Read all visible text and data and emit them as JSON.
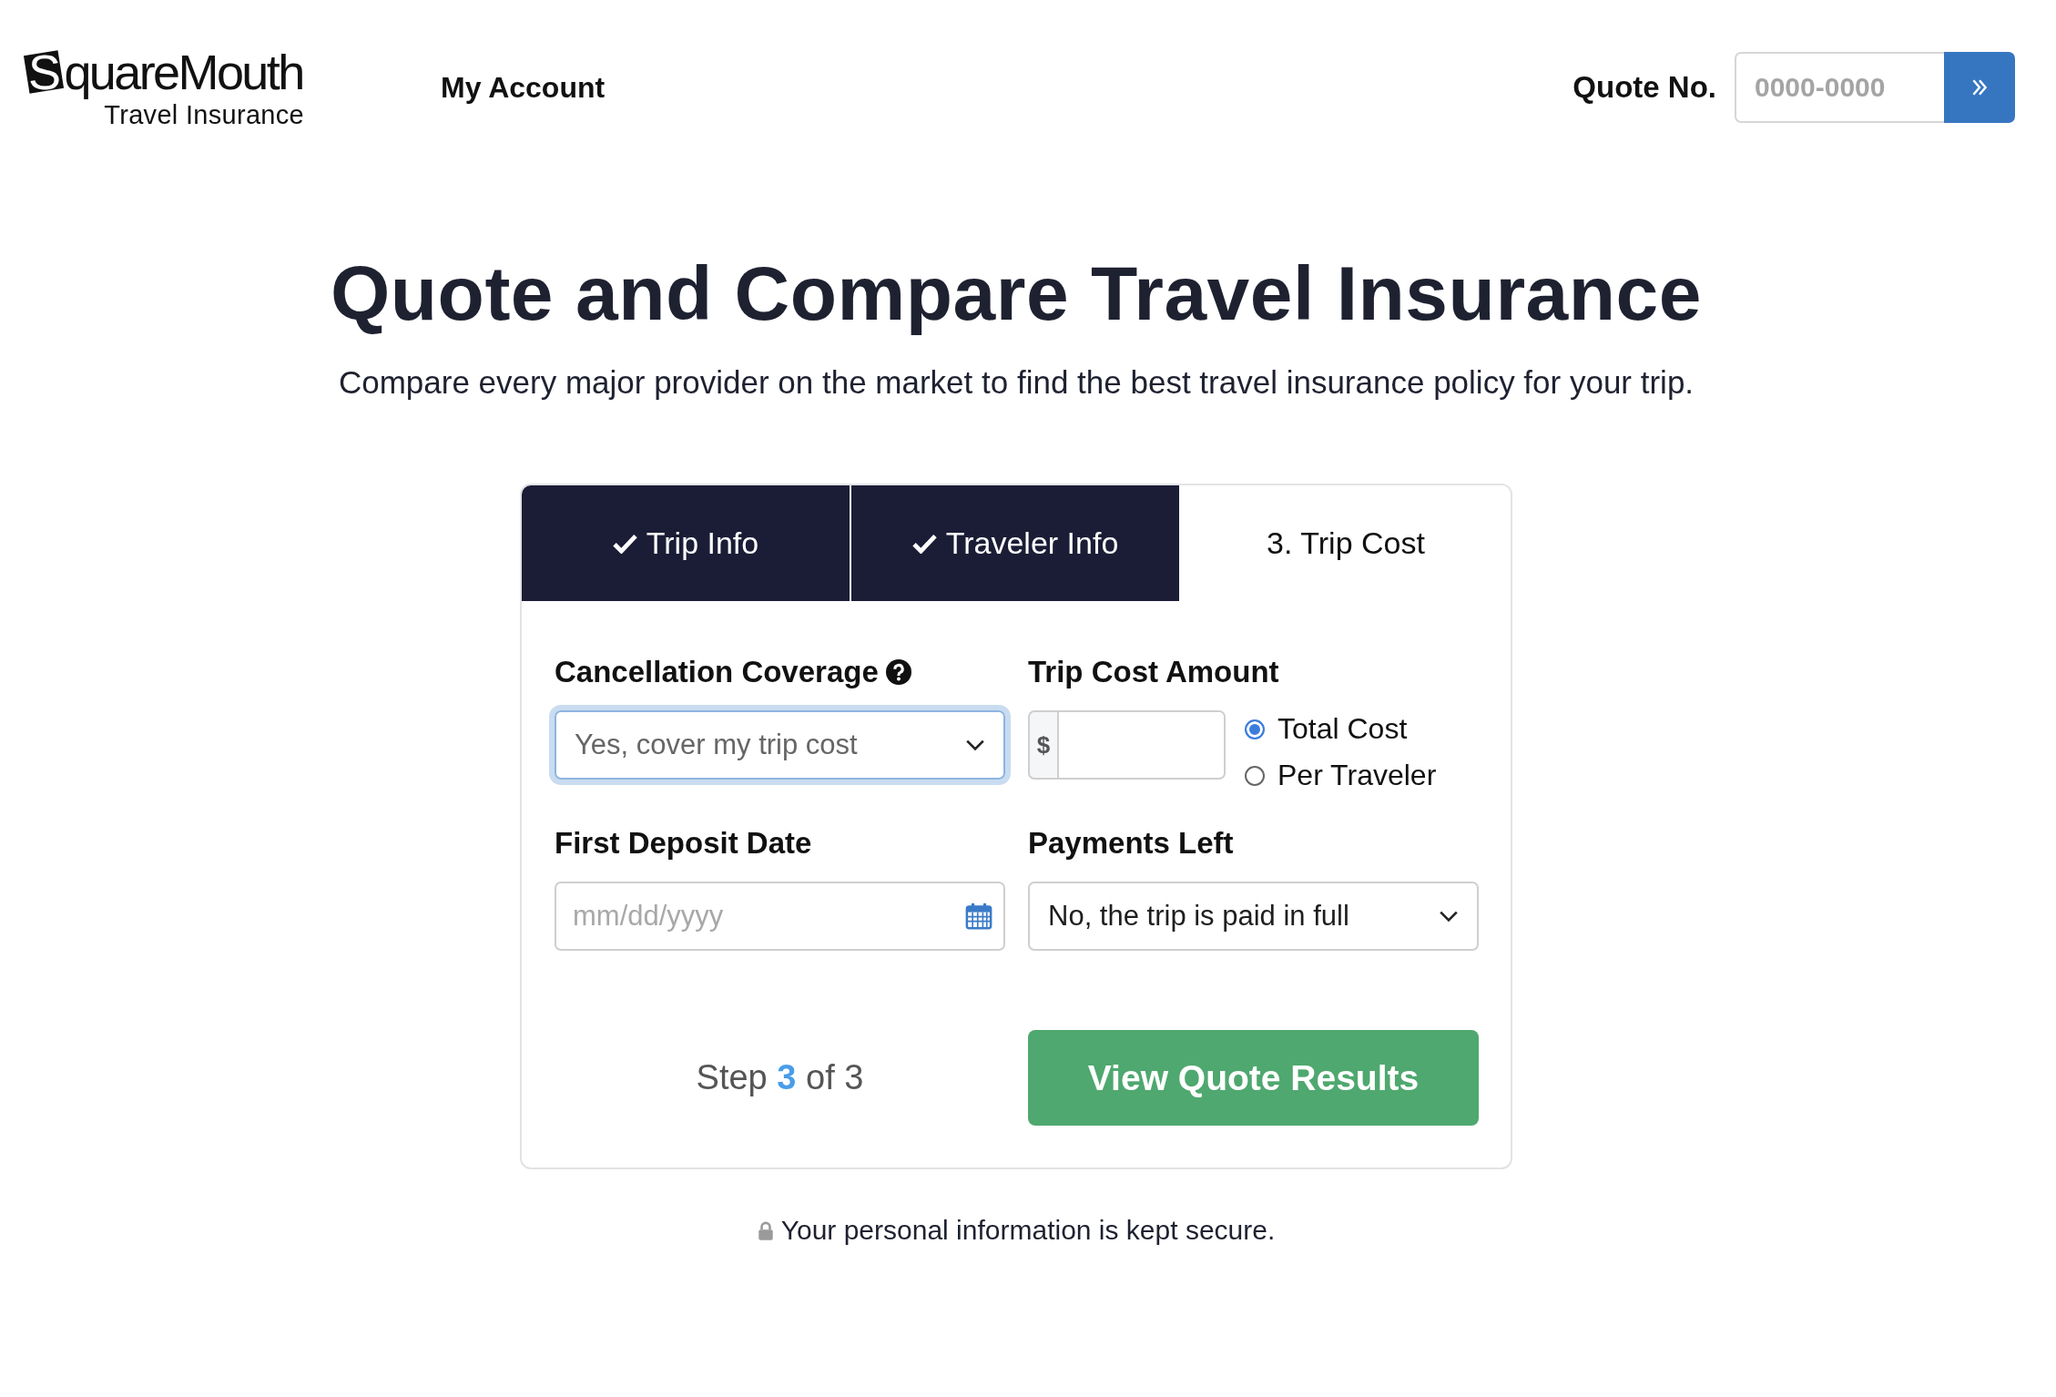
{
  "header": {
    "logo": {
      "name": "SquareMouth",
      "tagline": "Travel Insurance"
    },
    "nav": [
      {
        "label": "My Account"
      }
    ],
    "quote_lookup": {
      "label": "Quote No.",
      "placeholder": "0000-0000"
    }
  },
  "hero": {
    "title": "Quote and Compare Travel Insurance",
    "subtitle": "Compare every major provider on the market to find the best travel insurance policy for your trip."
  },
  "quote_form": {
    "steps": [
      {
        "label": "Trip Info",
        "completed": true,
        "selected": false
      },
      {
        "label": "Traveler Info",
        "completed": true,
        "selected": false
      },
      {
        "label": "3. Trip Cost",
        "completed": false,
        "selected": true
      }
    ],
    "cancellation_coverage": {
      "label": "Cancellation Coverage",
      "value": "Yes, cover my trip cost",
      "focused": true
    },
    "trip_cost_amount": {
      "label": "Trip Cost Amount",
      "prefix": "$",
      "options": [
        {
          "label": "Total Cost",
          "selected": true
        },
        {
          "label": "Per Traveler",
          "selected": false
        }
      ]
    },
    "first_deposit_date": {
      "label": "First Deposit Date",
      "placeholder": "mm/dd/yyyy"
    },
    "payments_left": {
      "label": "Payments Left",
      "value": "No, the trip is paid in full",
      "focused": false
    },
    "progress": "Step **3** of 3",
    "submit": {
      "label": "View Quote Results"
    }
  },
  "security_note": "Your personal information is kept secure."
}
